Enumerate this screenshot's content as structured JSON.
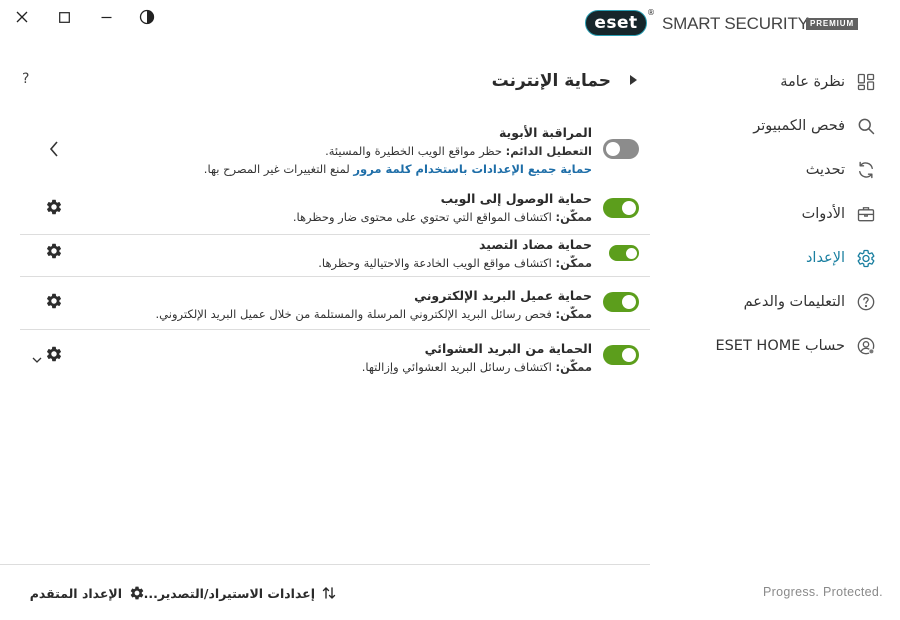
{
  "window": {
    "controls": [
      "close-icon",
      "maximize-icon",
      "minimize-icon",
      "theme-toggle-icon"
    ]
  },
  "brand": {
    "logo": "eset",
    "registered": "®",
    "product": "SMART SECURITY",
    "edition": "PREMIUM"
  },
  "sidebar": {
    "items": [
      {
        "label": "نظرة عامة",
        "icon": "dashboard-icon",
        "active": false
      },
      {
        "label": "فحص الكمبيوتر",
        "icon": "search-icon",
        "active": false
      },
      {
        "label": "تحديث",
        "icon": "refresh-icon",
        "active": false
      },
      {
        "label": "الأدوات",
        "icon": "toolbox-icon",
        "active": false
      },
      {
        "label": "الإعداد",
        "icon": "gear-icon",
        "active": true
      },
      {
        "label": "التعليمات والدعم",
        "icon": "help-circle-icon",
        "active": false
      },
      {
        "label": "حساب ESET HOME",
        "icon": "user-circle-icon",
        "active": false
      }
    ],
    "footer": "Progress. Protected."
  },
  "main": {
    "help": "?",
    "title": "حماية الإنترنت",
    "rows": [
      {
        "title": "المراقبة الأبوية",
        "status_label": "التعطيل الدائم:",
        "status_text": "حظر مواقع الويب الخطيرة والمسيئة.",
        "link": "حماية جميع الإعدادات باستخدام كلمة مرور",
        "link_suffix": "لمنع التغييرات غير المصرح بها.",
        "enabled": false,
        "action_icon": "chevron-left-icon"
      },
      {
        "title": "حماية الوصول إلى الويب",
        "status_label": "ممكّن:",
        "status_text": "اكتشاف المواقع التي تحتوي على محتوى ضار وحظرها.",
        "enabled": true,
        "action_icon": "gear-icon"
      },
      {
        "title": "حماية مضاد التصيد",
        "status_label": "ممكّن:",
        "status_text": "اكتشاف مواقع الويب الخادعة والاحتيالية وحظرها.",
        "enabled": true,
        "action_icon": "gear-icon"
      },
      {
        "title": "حماية عميل البريد الإلكتروني",
        "status_label": "ممكّن:",
        "status_text": "فحص رسائل البريد الإلكتروني المرسلة والمستلمة من خلال عميل البريد الإلكتروني.",
        "enabled": true,
        "action_icon": "gear-icon"
      },
      {
        "title": "الحماية من البريد العشوائي",
        "status_label": "ممكّن:",
        "status_text": "اكتشاف رسائل البريد العشوائي وإزالتها.",
        "enabled": true,
        "action_icon": "gear-icon"
      }
    ],
    "bottom": {
      "import_export": "إعدادات الاستيراد/التصدير...",
      "import_export_icon": "import-export-icon",
      "advanced": "الإعداد المتقدم",
      "advanced_icon": "gear-icon"
    }
  },
  "colors": {
    "accent": "#1a7fa0",
    "toggle_on": "#5c9e1c",
    "toggle_off": "#8c8c8c",
    "link": "#1e6ea8"
  }
}
